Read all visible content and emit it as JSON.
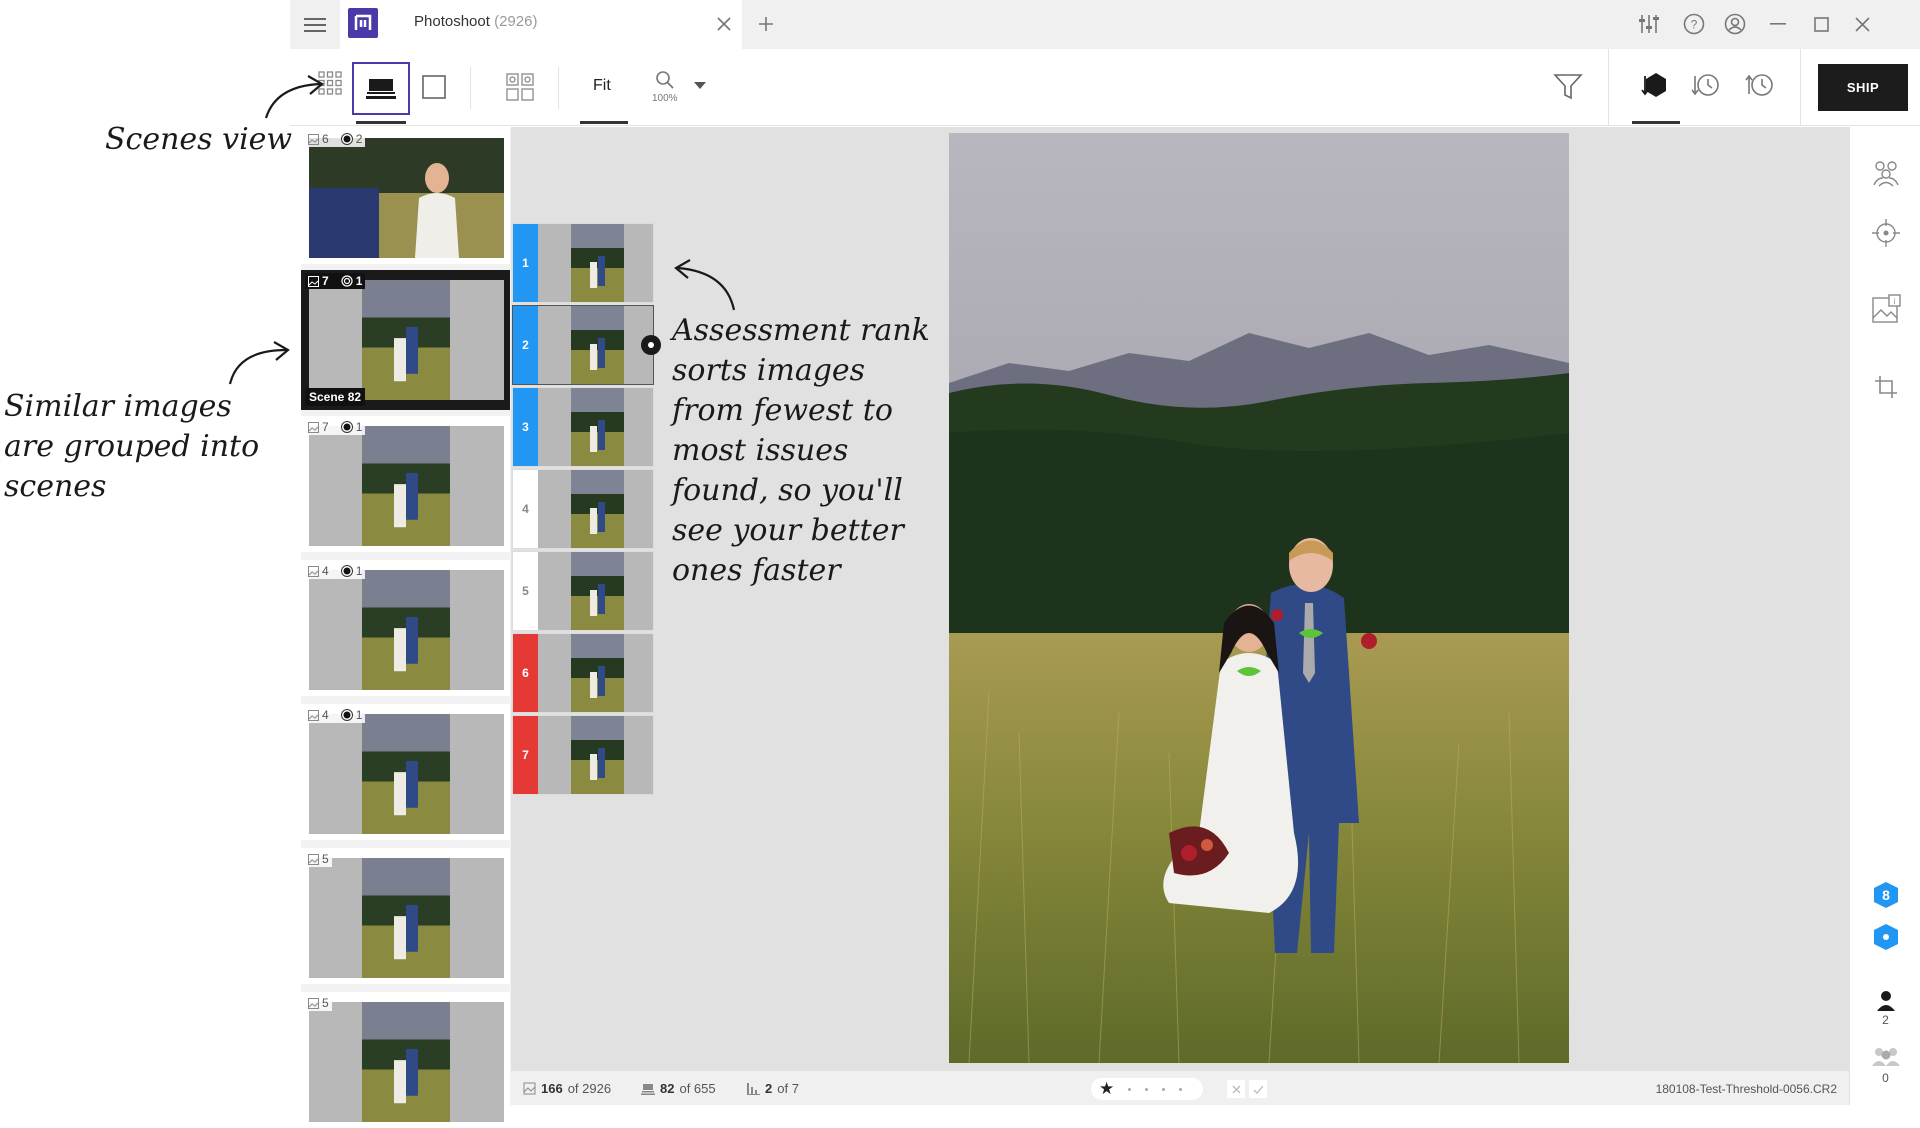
{
  "app": {
    "tab_title": "Photoshoot",
    "tab_count": "(2926)"
  },
  "toolbar": {
    "fit_label": "Fit",
    "zoom_level": "100%",
    "ship_label": "SHIP"
  },
  "annotations": {
    "scenes_view": "Scenes view",
    "similar_images": "Similar images are grouped into scenes",
    "assessment_rank": "Assessment rank sorts images from fewest to most issues found, so you'll see your better ones faster"
  },
  "scenes": [
    {
      "images": "6",
      "faces": "2",
      "selected": false
    },
    {
      "images": "7",
      "faces": "1",
      "selected": true,
      "label": "Scene 82"
    },
    {
      "images": "7",
      "faces": "1",
      "selected": false
    },
    {
      "images": "4",
      "faces": "1",
      "selected": false
    },
    {
      "images": "4",
      "faces": "1",
      "selected": false
    },
    {
      "images": "5",
      "faces": "",
      "selected": false
    },
    {
      "images": "5",
      "faces": "",
      "selected": false
    }
  ],
  "ranks": [
    {
      "num": "1",
      "color": "#2196f3"
    },
    {
      "num": "2",
      "color": "#2196f3"
    },
    {
      "num": "3",
      "color": "#2196f3"
    },
    {
      "num": "4",
      "color": "#ffffff"
    },
    {
      "num": "5",
      "color": "#ffffff"
    },
    {
      "num": "6",
      "color": "#e53935"
    },
    {
      "num": "7",
      "color": "#e53935"
    }
  ],
  "status": {
    "image_index": "166",
    "image_total": "of 2926",
    "scene_index": "82",
    "scene_total": "of 655",
    "rank_index": "2",
    "rank_total": "of 7",
    "filename": "180108-Test-Threshold-0056.CR2"
  },
  "rail": {
    "badge_count": "8",
    "person_count_1": "2",
    "person_count_2": "0"
  },
  "colors": {
    "accent_blue": "#2196f3",
    "accent_red": "#e53935",
    "brand_purple": "#4a3aa8",
    "ship_bg": "#1c1c1c"
  }
}
